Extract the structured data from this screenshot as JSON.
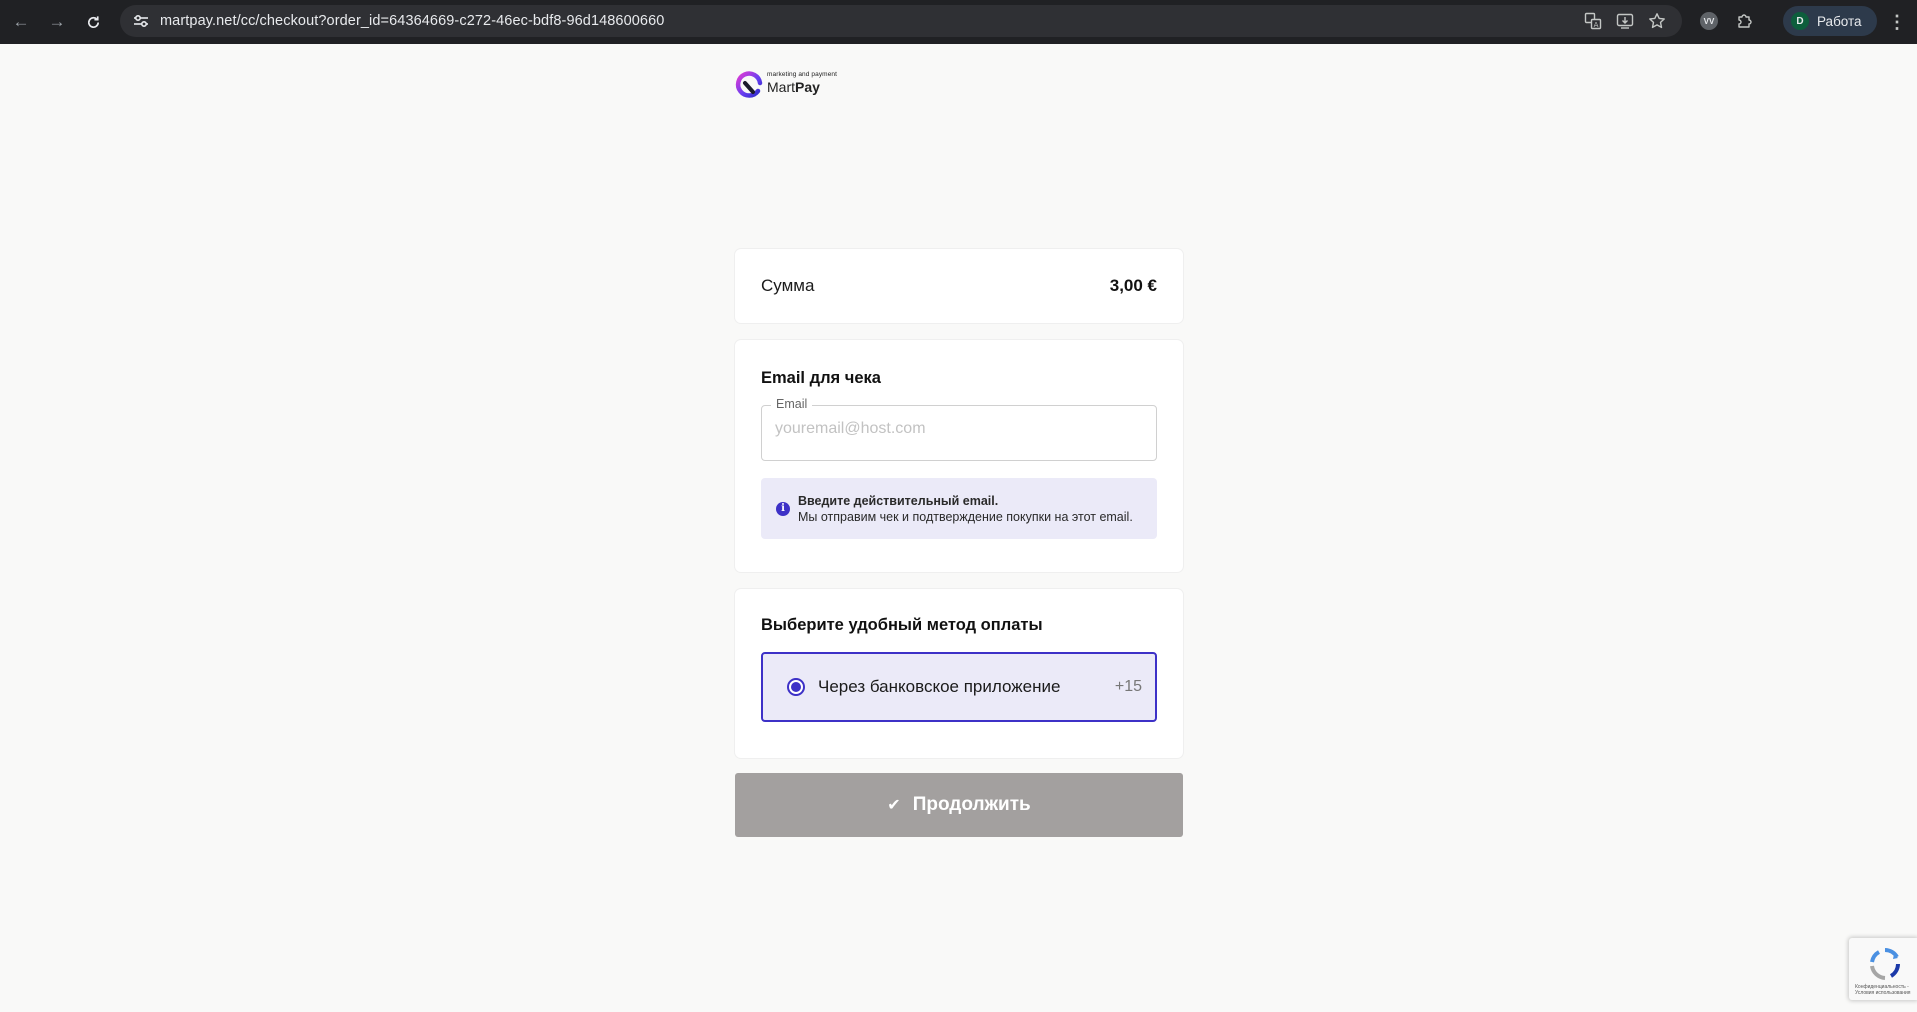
{
  "browser": {
    "url": "martpay.net/cc/checkout?order_id=64364669-c272-46ec-bdf8-96d148600660",
    "profile_initial": "D",
    "profile_name": "Работа",
    "extension_label": "VV"
  },
  "brand": {
    "tagline": "marketing and payment",
    "name_part1": "Mart",
    "name_part2": "Pay",
    "accent_color": "#3d31c7"
  },
  "summary": {
    "amount_label": "Сумма",
    "amount_value": "3,00 €"
  },
  "email_section": {
    "title": "Email для чека",
    "field_label": "Email",
    "field_placeholder": "youremail@host.com",
    "field_value": "",
    "notice_title": "Введите действительный email.",
    "notice_text": "Мы отправим чек и подтверждение покупки на этот email."
  },
  "payment_section": {
    "title": "Выберите удобный метод оплаты",
    "options": [
      {
        "label": "Через банковское приложение",
        "count": "+15",
        "selected": true
      }
    ]
  },
  "actions": {
    "continue_label": "Продолжить"
  },
  "recaptcha": {
    "text_line1": "Конфиденциальность -",
    "text_line2": "Условия использования"
  }
}
